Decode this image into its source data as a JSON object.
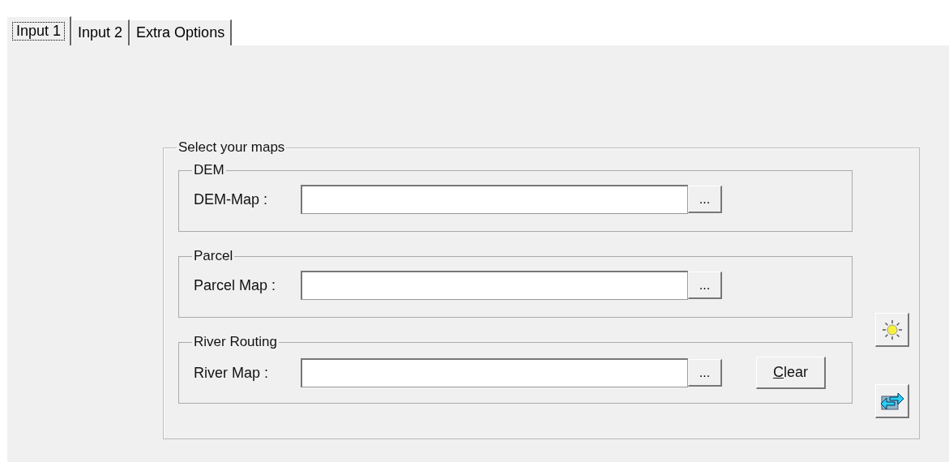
{
  "tabs": [
    {
      "label": "Input 1",
      "selected": true
    },
    {
      "label": "Input 2",
      "selected": false
    },
    {
      "label": "Extra Options",
      "selected": false
    }
  ],
  "maps_group": {
    "title": "Select your maps",
    "groups": [
      {
        "title": "DEM",
        "field_label": "DEM-Map :",
        "browse": "..."
      },
      {
        "title": "Parcel",
        "field_label": "Parcel Map :",
        "browse": "..."
      },
      {
        "title": "River Routing",
        "field_label": "River Map :",
        "browse": "...",
        "clear_button": {
          "label": "Clear"
        }
      }
    ],
    "side_buttons": [
      {
        "kind": "sun"
      },
      {
        "kind": "swap"
      }
    ]
  }
}
